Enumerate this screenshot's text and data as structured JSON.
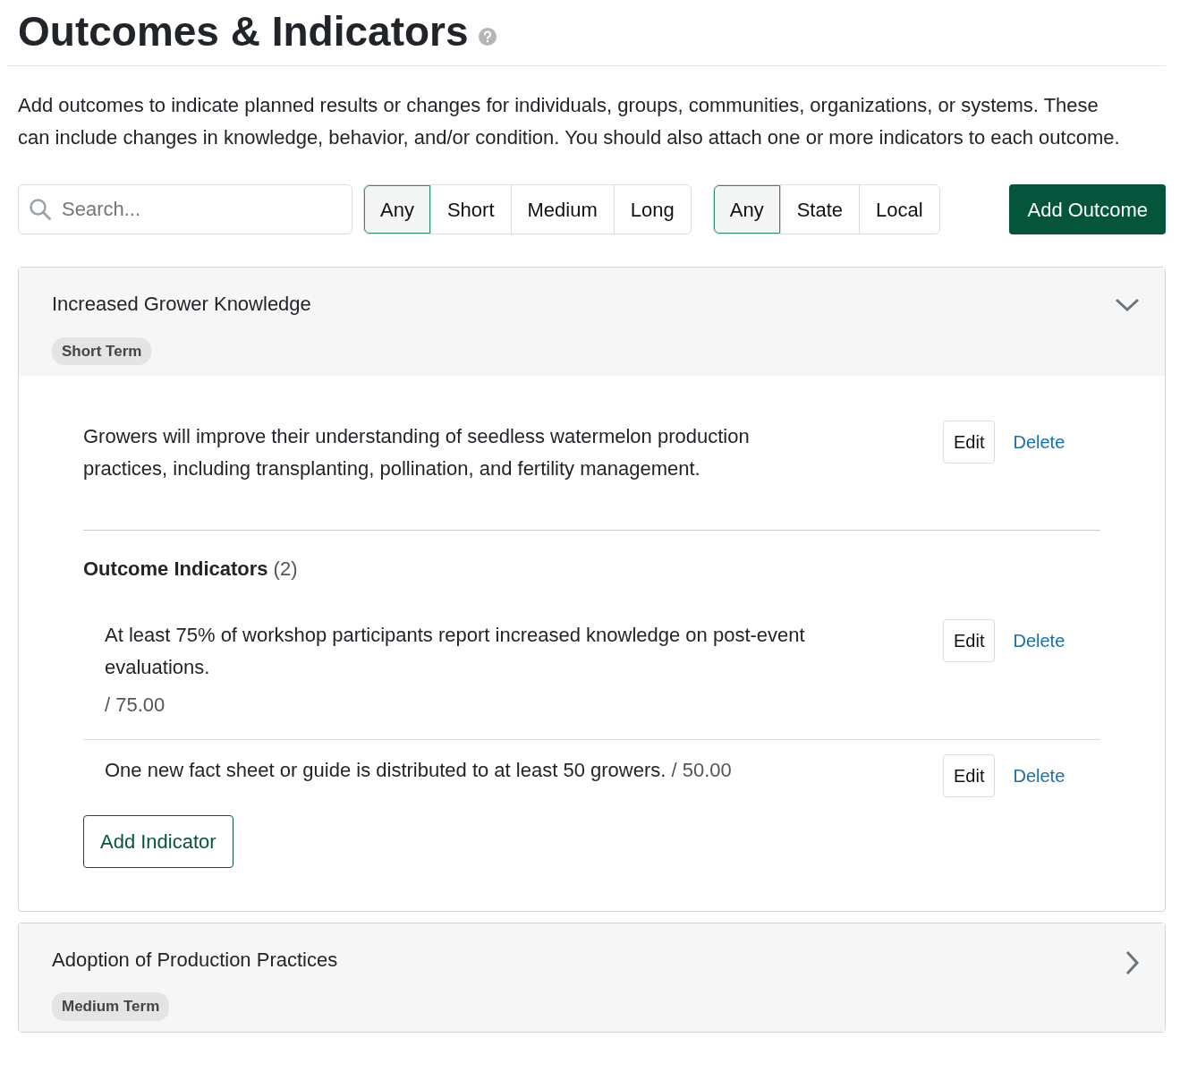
{
  "title": "Outcomes & Indicators",
  "intro": "Add outcomes to indicate planned results or changes for individuals, groups, communities, organizations, or systems. These can include changes in knowledge, behavior, and/or condition. You should also attach one or more indicators to each outcome.",
  "search": {
    "placeholder": "Search..."
  },
  "term_filter": [
    {
      "label": "Any",
      "selected": true
    },
    {
      "label": "Short",
      "selected": false
    },
    {
      "label": "Medium",
      "selected": false
    },
    {
      "label": "Long",
      "selected": false
    }
  ],
  "scope_filter": [
    {
      "label": "Any",
      "selected": true
    },
    {
      "label": "State",
      "selected": false
    },
    {
      "label": "Local",
      "selected": false
    }
  ],
  "add_outcome_button": "Add Outcome",
  "outcomes": [
    {
      "title": "Increased Grower Knowledge",
      "term": "Short Term",
      "expanded": true,
      "description": "Growers will improve their understanding of seedless watermelon production practices, including transplanting, pollination, and fertility management.",
      "edit": "Edit",
      "delete": "Delete",
      "indicators_heading": "Outcome Indicators",
      "indicators_count": "(2)",
      "indicators": [
        {
          "kind": "stacked",
          "text": "At least 75% of workshop participants report increased knowledge on post-event evaluations.",
          "target": "/ 75.00",
          "edit": "Edit",
          "delete": "Delete"
        },
        {
          "kind": "inline",
          "text": "One new fact sheet or guide is distributed to at least 50 growers.",
          "target": "/ 50.00",
          "edit": "Edit",
          "delete": "Delete"
        }
      ],
      "add_indicator_button": "Add Indicator"
    },
    {
      "title": "Adoption of Production Practices",
      "term": "Medium Term",
      "expanded": false
    }
  ]
}
